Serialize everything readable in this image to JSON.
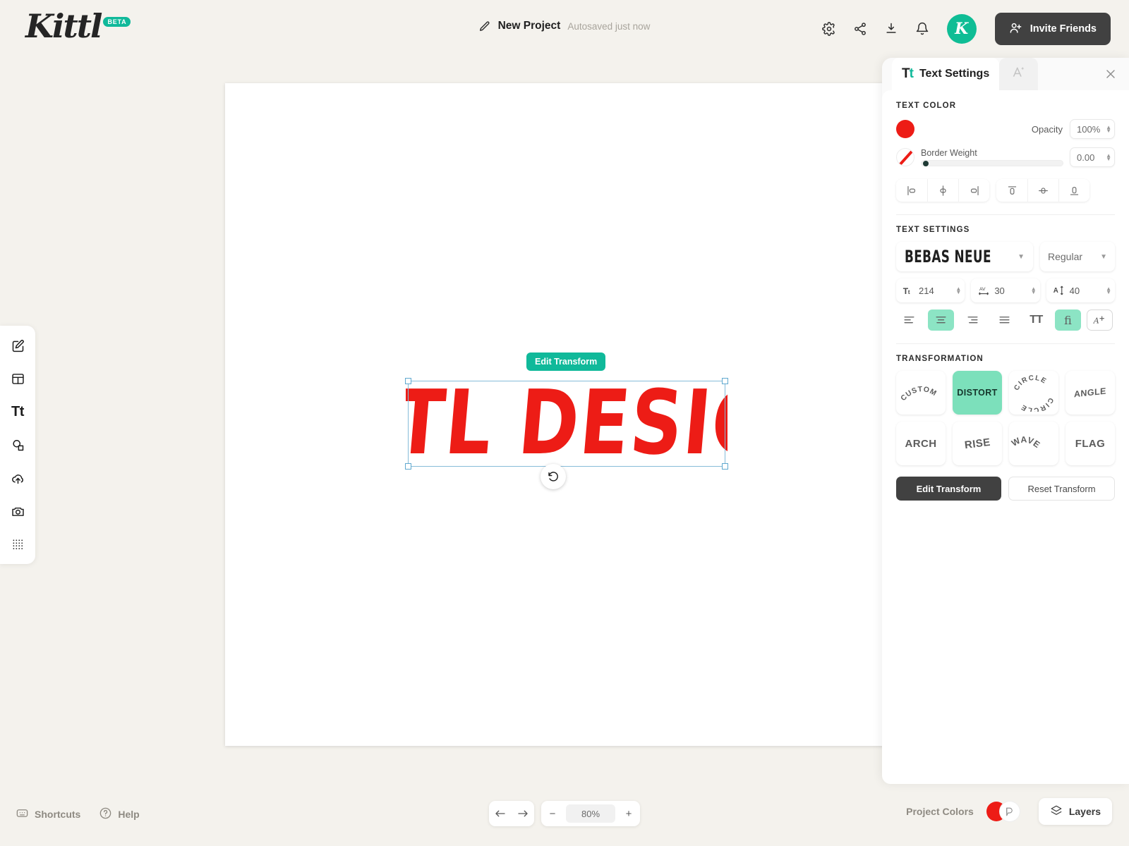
{
  "app": {
    "logo_text": "Kittl",
    "logo_badge": "BETA"
  },
  "header": {
    "project_name": "New Project",
    "autosave_status": "Autosaved just now",
    "invite_label": "Invite Friends",
    "avatar_initial": "K",
    "icons": [
      "gear-icon",
      "share-icon",
      "download-icon",
      "bell-icon"
    ]
  },
  "left_toolbar": {
    "items": [
      {
        "name": "design-tool",
        "icon": "pencil-square-icon"
      },
      {
        "name": "templates-tool",
        "icon": "layout-icon"
      },
      {
        "name": "text-tool",
        "icon": "text-tt-icon",
        "label": "Tt"
      },
      {
        "name": "elements-tool",
        "icon": "shapes-icon"
      },
      {
        "name": "uploads-tool",
        "icon": "cloud-upload-icon"
      },
      {
        "name": "photos-tool",
        "icon": "camera-icon"
      },
      {
        "name": "patterns-tool",
        "icon": "dots-grid-icon"
      }
    ]
  },
  "canvas": {
    "artwork_text": "KITTL DESIGN",
    "artwork_color": "#ed1c16",
    "edit_transform_badge": "Edit Transform"
  },
  "panel": {
    "title": "Text Settings",
    "tab_effects_icon": "magic-a-icon",
    "close_icon": "close-icon",
    "text_color": {
      "section_label": "TEXT COLOR",
      "fill_color": "#ed1c16",
      "opacity_label": "Opacity",
      "opacity_value": "100%",
      "border_label": "Border Weight",
      "border_value": "0.00",
      "border_slider_pct": 0
    },
    "align_buttons": [
      {
        "name": "align-left",
        "icon": "align-left-icon"
      },
      {
        "name": "align-center-h",
        "icon": "align-center-horizontal-icon"
      },
      {
        "name": "align-right",
        "icon": "align-right-icon"
      },
      {
        "name": "align-top",
        "icon": "align-top-icon"
      },
      {
        "name": "align-middle-v",
        "icon": "align-middle-vertical-icon"
      },
      {
        "name": "align-bottom",
        "icon": "align-bottom-icon"
      }
    ],
    "text_settings": {
      "section_label": "TEXT SETTINGS",
      "font_family": "BEBAS NEUE",
      "font_weight": "Regular",
      "font_size": "214",
      "letter_spacing": "30",
      "line_height": "40",
      "style_buttons": [
        {
          "name": "text-align-left",
          "icon": "text-align-left-icon",
          "active": false
        },
        {
          "name": "text-align-center",
          "icon": "text-align-center-icon",
          "active": true
        },
        {
          "name": "text-align-right",
          "icon": "text-align-right-icon",
          "active": false
        },
        {
          "name": "text-align-justify",
          "icon": "text-align-justify-icon",
          "active": false
        },
        {
          "name": "uppercase-toggle",
          "icon": "uppercase-tt-icon",
          "label": "TT",
          "active": false
        },
        {
          "name": "ligatures-toggle",
          "icon": "ligature-fi-icon",
          "label": "fi",
          "active": true
        },
        {
          "name": "font-effects",
          "icon": "font-effects-icon",
          "active": false
        }
      ]
    },
    "transformation": {
      "section_label": "TRANSFORMATION",
      "options": [
        {
          "label": "CUSTOM",
          "style": "custom",
          "active": false
        },
        {
          "label": "DISTORT",
          "style": "distort",
          "active": true
        },
        {
          "label": "CIRCLE",
          "style": "circle",
          "active": false
        },
        {
          "label": "ANGLE",
          "style": "angle",
          "active": false
        },
        {
          "label": "ARCH",
          "style": "arch",
          "active": false
        },
        {
          "label": "RISE",
          "style": "rise",
          "active": false
        },
        {
          "label": "WAVE",
          "style": "wave",
          "active": false
        },
        {
          "label": "FLAG",
          "style": "flag",
          "active": false
        }
      ],
      "edit_button": "Edit Transform",
      "reset_button": "Reset Transform"
    }
  },
  "footer": {
    "shortcuts_label": "Shortcuts",
    "help_label": "Help",
    "zoom_value": "80%",
    "zoom_out": "−",
    "zoom_in": "+",
    "project_colors_label": "Project Colors",
    "project_color_swatch": "#ed1c16",
    "layers_label": "Layers"
  }
}
